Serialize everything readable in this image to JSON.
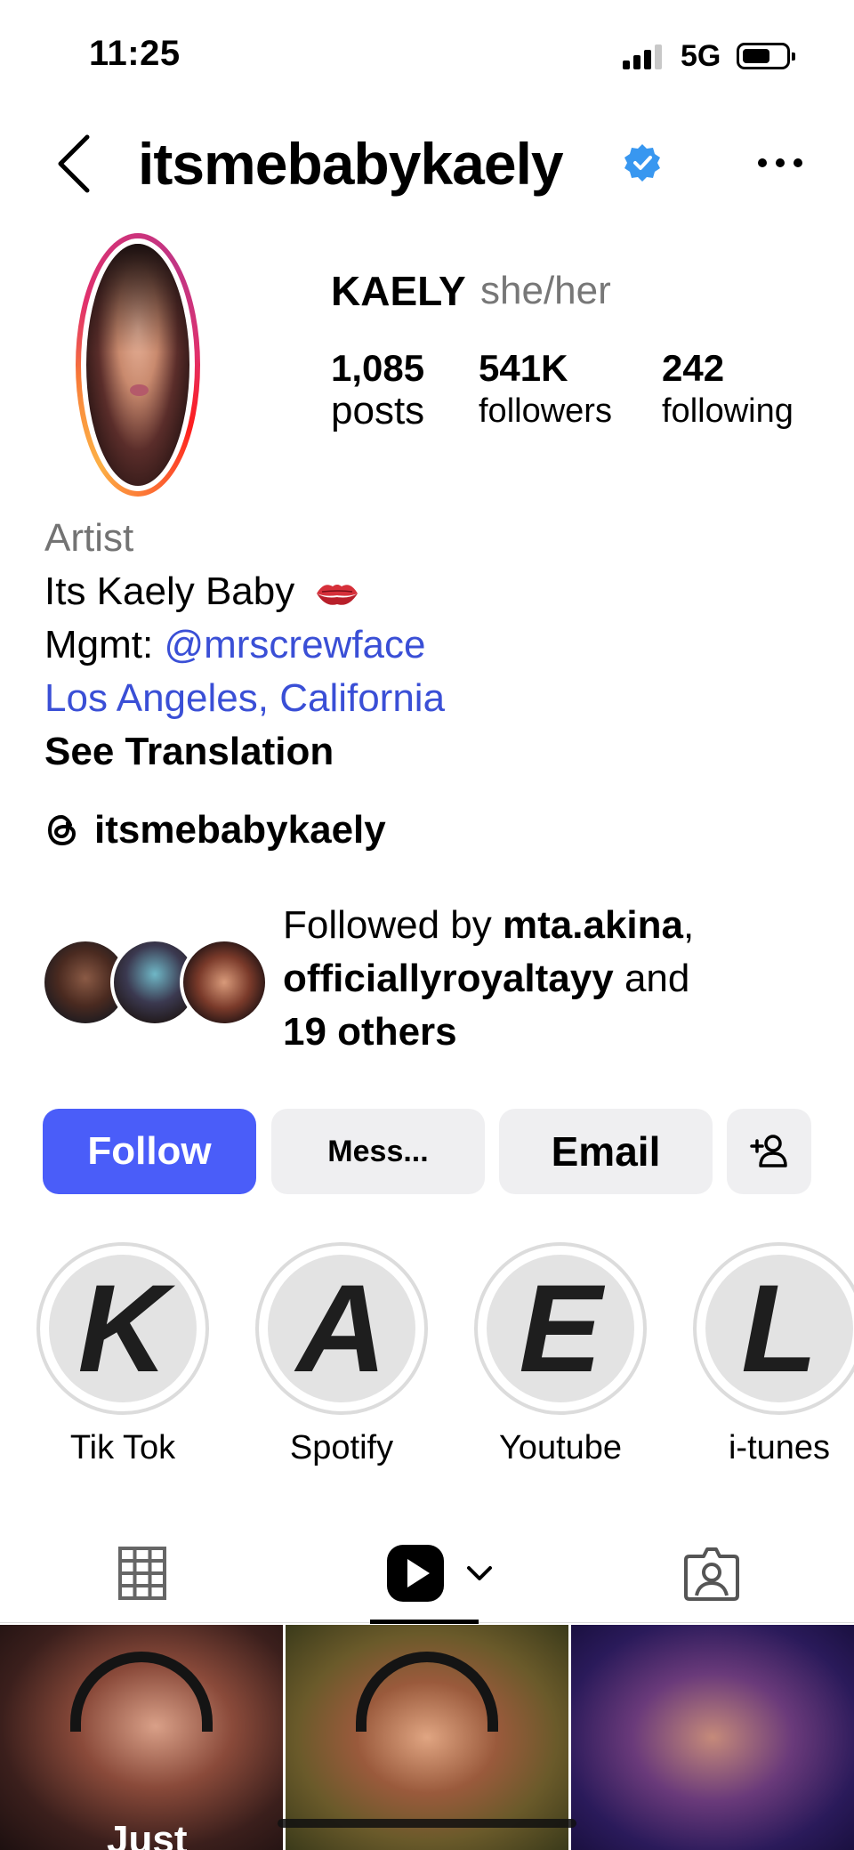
{
  "status_bar": {
    "time": "11:25",
    "network": "5G"
  },
  "header": {
    "username": "itsmebabykaely",
    "verified": true
  },
  "profile": {
    "display_name": "KAELY",
    "pronouns": "she/her",
    "stats": {
      "posts": {
        "value": "1,085",
        "label": "posts"
      },
      "followers": {
        "value": "541K",
        "label": "followers"
      },
      "following": {
        "value": "242",
        "label": "following"
      }
    },
    "category": "Artist",
    "bio_line1": "Its Kaely Baby",
    "bio_emoji": "kiss-mark-icon",
    "mgmt_prefix": "Mgmt: ",
    "mgmt_handle": "@mrscrewface",
    "location": "Los Angeles, California",
    "see_translation": "See Translation",
    "threads_handle": "itsmebabykaely"
  },
  "followed_by": {
    "prefix": "Followed by ",
    "user1": "mta.akina",
    "sep1": ",",
    "user2": "officiallyroyaltayy",
    "conj": " and",
    "others": "19 others"
  },
  "buttons": {
    "follow": "Follow",
    "message": "Mess...",
    "email": "Email",
    "add_user_icon": "add-user-icon"
  },
  "highlights": [
    {
      "letter": "K",
      "label": "Tik Tok"
    },
    {
      "letter": "A",
      "label": "Spotify"
    },
    {
      "letter": "E",
      "label": "Youtube"
    },
    {
      "letter": "L",
      "label": "i-tunes"
    }
  ],
  "tabs": {
    "active": "reels"
  },
  "grid": [
    {
      "caption": "Just"
    },
    {
      "caption": ""
    },
    {
      "caption": ""
    }
  ],
  "colors": {
    "accent": "#4a5df9",
    "link": "#3a4fd6",
    "verified": "#3897f0",
    "secondary_text": "#737373"
  }
}
